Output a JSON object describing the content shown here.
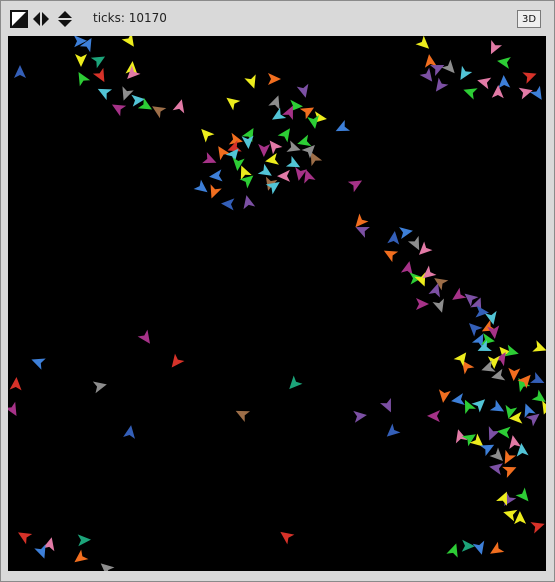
{
  "toolbar": {
    "ticks_label": "ticks: 10170",
    "view_3d_label": "3D",
    "icons": [
      "edit-toggle-icon",
      "horizontal-arrows-icon",
      "vertical-arrows-icon"
    ]
  },
  "world": {
    "background": "#000000",
    "turtle_shape": "default-arrowhead",
    "colors": {
      "red": "#d73229",
      "orange": "#f16e1f",
      "yellow": "#eded1d",
      "lime": "#2dcd35",
      "green": "#1ca47a",
      "cyan": "#52c4d6",
      "sky": "#3d7fd8",
      "blue": "#345fb8",
      "violet": "#7c50a4",
      "magenta": "#a63288",
      "pink": "#e27aa6",
      "brown": "#9d6e48",
      "gray": "#8d8d8d"
    },
    "turtles": [
      [
        "blue",
        12,
        36,
        0
      ],
      [
        "sky",
        80,
        8,
        30
      ],
      [
        "yellow",
        122,
        5,
        0
      ],
      [
        "yellow",
        73,
        24,
        180
      ],
      [
        "green",
        91,
        24,
        60
      ],
      [
        "yellow",
        124,
        32,
        0
      ],
      [
        "lime",
        74,
        42,
        -30
      ],
      [
        "red",
        93,
        40,
        0
      ],
      [
        "pink",
        124,
        38,
        0
      ],
      [
        "cyan",
        96,
        56,
        0
      ],
      [
        "gray",
        118,
        58,
        200
      ],
      [
        "cyan",
        130,
        64,
        0
      ],
      [
        "magenta",
        110,
        72,
        -60
      ],
      [
        "lime",
        138,
        70,
        120
      ],
      [
        "brown",
        150,
        74,
        0
      ],
      [
        "pink",
        172,
        70,
        0
      ],
      [
        "sky",
        72,
        5,
        0
      ],
      [
        "yellow",
        244,
        46,
        0
      ],
      [
        "orange",
        266,
        43,
        90
      ],
      [
        "yellow",
        224,
        66,
        0
      ],
      [
        "gray",
        268,
        66,
        0
      ],
      [
        "lime",
        288,
        70,
        0
      ],
      [
        "violet",
        296,
        55,
        0
      ],
      [
        "cyan",
        270,
        80,
        0
      ],
      [
        "orange",
        300,
        75,
        60
      ],
      [
        "magenta",
        282,
        76,
        0
      ],
      [
        "yellow",
        312,
        82,
        0
      ],
      [
        "lime",
        306,
        86,
        0
      ],
      [
        "sky",
        334,
        92,
        0
      ],
      [
        "yellow",
        198,
        98,
        0
      ],
      [
        "lime",
        242,
        98,
        0
      ],
      [
        "orange",
        228,
        104,
        0
      ],
      [
        "cyan",
        240,
        106,
        0
      ],
      [
        "red",
        226,
        112,
        0
      ],
      [
        "pink",
        266,
        110,
        0
      ],
      [
        "lime",
        278,
        98,
        0
      ],
      [
        "gray",
        286,
        112,
        0
      ],
      [
        "magenta",
        256,
        114,
        0
      ],
      [
        "lime",
        296,
        106,
        0
      ],
      [
        "orange",
        214,
        116,
        0
      ],
      [
        "cyan",
        226,
        118,
        0
      ],
      [
        "magenta",
        202,
        124,
        0
      ],
      [
        "lime",
        230,
        128,
        0
      ],
      [
        "yellow",
        264,
        124,
        0
      ],
      [
        "brown",
        306,
        122,
        0
      ],
      [
        "gray",
        302,
        114,
        0
      ],
      [
        "cyan",
        286,
        128,
        0
      ],
      [
        "magenta",
        292,
        138,
        0
      ],
      [
        "sky",
        208,
        140,
        0
      ],
      [
        "yellow",
        236,
        136,
        0
      ],
      [
        "lime",
        240,
        144,
        0
      ],
      [
        "cyan",
        258,
        136,
        0
      ],
      [
        "brown",
        262,
        148,
        0
      ],
      [
        "pink",
        276,
        140,
        0
      ],
      [
        "magenta",
        300,
        140,
        0
      ],
      [
        "cyan",
        266,
        150,
        0
      ],
      [
        "sky",
        194,
        152,
        0
      ],
      [
        "orange",
        206,
        156,
        0
      ],
      [
        "blue",
        220,
        168,
        0
      ],
      [
        "violet",
        240,
        166,
        0
      ],
      [
        "magenta",
        348,
        148,
        0
      ],
      [
        "yellow",
        416,
        8,
        0
      ],
      [
        "pink",
        486,
        12,
        0
      ],
      [
        "lime",
        496,
        26,
        0
      ],
      [
        "orange",
        422,
        25,
        0
      ],
      [
        "violet",
        430,
        32,
        0
      ],
      [
        "gray",
        442,
        32,
        0
      ],
      [
        "cyan",
        456,
        38,
        0
      ],
      [
        "pink",
        476,
        46,
        0
      ],
      [
        "sky",
        496,
        46,
        0
      ],
      [
        "red",
        522,
        40,
        0
      ],
      [
        "violet",
        420,
        40,
        0
      ],
      [
        "violet",
        432,
        50,
        0
      ],
      [
        "lime",
        462,
        56,
        0
      ],
      [
        "pink",
        490,
        56,
        0
      ],
      [
        "pink",
        518,
        56,
        0
      ],
      [
        "sky",
        530,
        58,
        0
      ],
      [
        "orange",
        352,
        186,
        0
      ],
      [
        "violet",
        354,
        194,
        0
      ],
      [
        "blue",
        386,
        202,
        0
      ],
      [
        "sky",
        398,
        196,
        0
      ],
      [
        "gray",
        408,
        208,
        0
      ],
      [
        "pink",
        416,
        214,
        0
      ],
      [
        "orange",
        382,
        218,
        0
      ],
      [
        "magenta",
        400,
        232,
        0
      ],
      [
        "lime",
        408,
        242,
        0
      ],
      [
        "yellow",
        414,
        244,
        0
      ],
      [
        "pink",
        420,
        238,
        0
      ],
      [
        "brown",
        432,
        246,
        0
      ],
      [
        "violet",
        428,
        254,
        0
      ],
      [
        "magenta",
        414,
        268,
        0
      ],
      [
        "gray",
        432,
        270,
        0
      ],
      [
        "magenta",
        450,
        260,
        0
      ],
      [
        "violet",
        462,
        262,
        0
      ],
      [
        "violet",
        470,
        268,
        0
      ],
      [
        "blue",
        474,
        276,
        0
      ],
      [
        "cyan",
        484,
        282,
        0
      ],
      [
        "orange",
        480,
        292,
        0
      ],
      [
        "blue",
        466,
        292,
        0
      ],
      [
        "sky",
        472,
        304,
        0
      ],
      [
        "lime",
        480,
        304,
        0
      ],
      [
        "magenta",
        486,
        296,
        0
      ],
      [
        "cyan",
        476,
        312,
        0
      ],
      [
        "yellow",
        496,
        316,
        0
      ],
      [
        "magenta",
        494,
        322,
        0
      ],
      [
        "lime",
        504,
        316,
        0
      ],
      [
        "yellow",
        486,
        326,
        0
      ],
      [
        "gray",
        480,
        332,
        0
      ],
      [
        "orange",
        458,
        330,
        0
      ],
      [
        "yellow",
        454,
        322,
        0
      ],
      [
        "yellow",
        532,
        312,
        0
      ],
      [
        "orange",
        506,
        338,
        0
      ],
      [
        "gray",
        490,
        340,
        0
      ],
      [
        "lime",
        514,
        348,
        0
      ],
      [
        "orange",
        518,
        344,
        0
      ],
      [
        "blue",
        530,
        344,
        0
      ],
      [
        "orange",
        436,
        360,
        0
      ],
      [
        "sky",
        450,
        364,
        0
      ],
      [
        "lime",
        460,
        370,
        0
      ],
      [
        "cyan",
        472,
        368,
        0
      ],
      [
        "sky",
        490,
        372,
        0
      ],
      [
        "lime",
        502,
        376,
        0
      ],
      [
        "yellow",
        508,
        382,
        0
      ],
      [
        "sky",
        520,
        374,
        0
      ],
      [
        "violet",
        526,
        382,
        0
      ],
      [
        "lime",
        532,
        362,
        0
      ],
      [
        "yellow",
        538,
        372,
        0
      ],
      [
        "magenta",
        426,
        380,
        0
      ],
      [
        "pink",
        452,
        400,
        0
      ],
      [
        "lime",
        462,
        402,
        0
      ],
      [
        "yellow",
        470,
        406,
        0
      ],
      [
        "violet",
        484,
        398,
        0
      ],
      [
        "lime",
        496,
        396,
        0
      ],
      [
        "pink",
        506,
        406,
        0
      ],
      [
        "sky",
        480,
        412,
        0
      ],
      [
        "gray",
        490,
        420,
        0
      ],
      [
        "orange",
        500,
        422,
        0
      ],
      [
        "violet",
        488,
        432,
        0
      ],
      [
        "cyan",
        514,
        414,
        0
      ],
      [
        "orange",
        502,
        434,
        0
      ],
      [
        "lime",
        516,
        460,
        0
      ],
      [
        "violet",
        500,
        464,
        0
      ],
      [
        "yellow",
        502,
        478,
        0
      ],
      [
        "yellow",
        512,
        482,
        0
      ],
      [
        "red",
        530,
        490,
        0
      ],
      [
        "magenta",
        138,
        302,
        0
      ],
      [
        "red",
        168,
        326,
        0
      ],
      [
        "sky",
        30,
        326,
        0
      ],
      [
        "red",
        8,
        348,
        0
      ],
      [
        "gray",
        92,
        350,
        0
      ],
      [
        "magenta",
        5,
        374,
        0
      ],
      [
        "green",
        286,
        348,
        0
      ],
      [
        "brown",
        234,
        378,
        0
      ],
      [
        "blue",
        122,
        396,
        0
      ],
      [
        "violet",
        352,
        380,
        0
      ],
      [
        "violet",
        380,
        370,
        0
      ],
      [
        "blue",
        384,
        396,
        0
      ],
      [
        "red",
        16,
        500,
        0
      ],
      [
        "pink",
        42,
        508,
        0
      ],
      [
        "green",
        76,
        504,
        0
      ],
      [
        "sky",
        34,
        516,
        0
      ],
      [
        "orange",
        72,
        522,
        0
      ],
      [
        "red",
        278,
        500,
        0
      ],
      [
        "lime",
        446,
        514,
        0
      ],
      [
        "green",
        460,
        510,
        0
      ],
      [
        "sky",
        472,
        512,
        0
      ],
      [
        "orange",
        488,
        514,
        0
      ],
      [
        "gray",
        98,
        532,
        0
      ],
      [
        "yellow",
        496,
        462,
        0
      ]
    ]
  }
}
